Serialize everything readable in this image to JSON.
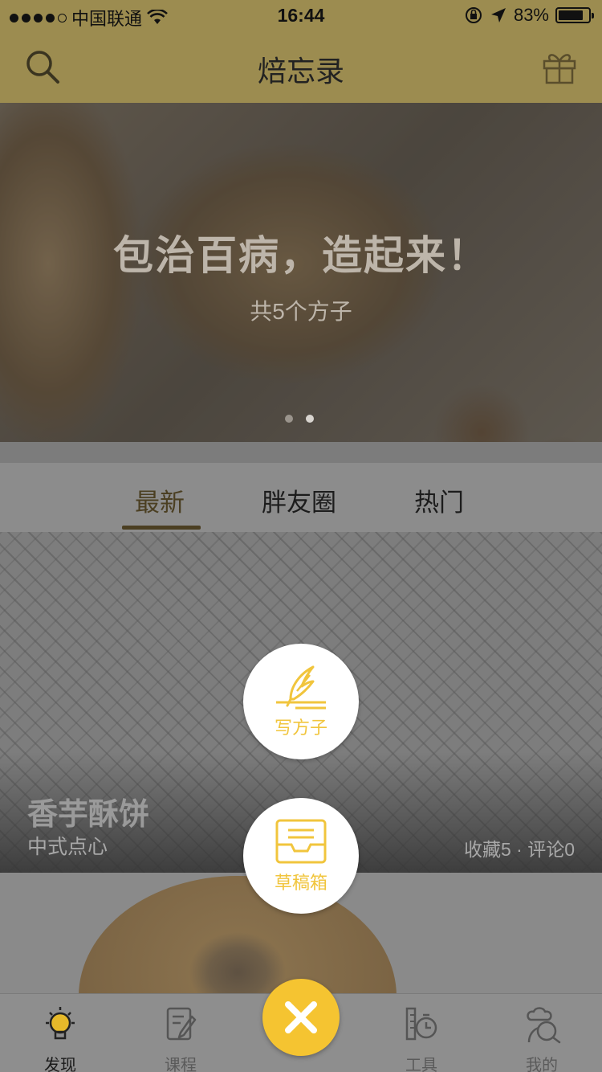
{
  "status_bar": {
    "carrier": "中国联通",
    "time": "16:44",
    "battery_percent": "83%",
    "battery_level": 0.83
  },
  "nav": {
    "title": "焙忘录",
    "left_icon": "search-icon",
    "right_icon": "gift-icon"
  },
  "banner": {
    "title": "包治百病，造起来！",
    "subtitle": "共5个方子",
    "page_count": 2,
    "active_page": 2
  },
  "tabs": [
    {
      "label": "最新",
      "active": true
    },
    {
      "label": "胖友圈",
      "active": false
    },
    {
      "label": "热门",
      "active": false
    }
  ],
  "card": {
    "title": "香芋酥饼",
    "category": "中式点心",
    "stats": "收藏5 · 评论0"
  },
  "actions": {
    "write_recipe": {
      "label": "写方子",
      "icon": "quill-icon"
    },
    "drafts": {
      "label": "草稿箱",
      "icon": "inbox-tray-icon"
    },
    "close_icon": "close-icon"
  },
  "tabbar": [
    {
      "label": "发现",
      "icon": "lightbulb-icon",
      "active": true
    },
    {
      "label": "课程",
      "icon": "notebook-pen-icon",
      "active": false
    },
    {
      "label": "工具",
      "icon": "timer-ruler-icon",
      "active": false
    },
    {
      "label": "我的",
      "icon": "chef-avatar-icon",
      "active": false
    }
  ],
  "colors": {
    "nav_bg": "#9c8c50",
    "accent": "#f5c431",
    "fab_label": "#f1c53d"
  }
}
